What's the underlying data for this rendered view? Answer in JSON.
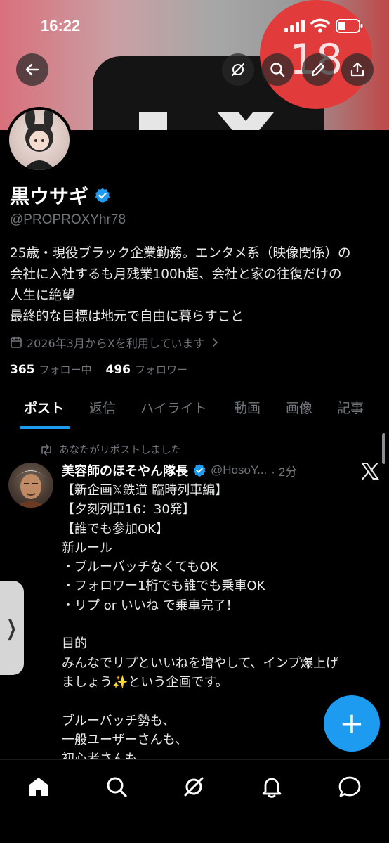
{
  "status_bar": {
    "time": "16:22"
  },
  "banner": {
    "badge_count": "18"
  },
  "top_actions": [
    {
      "name": "back-button",
      "icon": "arrow-left-icon"
    },
    {
      "name": "grok-button",
      "icon": "grok-icon"
    },
    {
      "name": "search-button",
      "icon": "search-icon"
    },
    {
      "name": "edit-button",
      "icon": "pencil-icon"
    },
    {
      "name": "share-button",
      "icon": "share-icon"
    }
  ],
  "profile": {
    "display_name": "黒ウサギ",
    "handle": "@PROPROXYhr78",
    "bio_lines": [
      "25歳・現役ブラック企業勤務。エンタメ系（映像関係）の",
      "会社に入社するも月残業100h超、会社と家の往復だけの",
      "人生に絶望",
      "最終的な目標は地元で自由に暮らすこと"
    ],
    "joined": "2026年3月からXを利用しています",
    "following_count": "365",
    "following_label": "フォロー中",
    "followers_count": "496",
    "followers_label": "フォロワー"
  },
  "tabs": [
    {
      "label": "ポスト",
      "active": true
    },
    {
      "label": "返信",
      "active": false
    },
    {
      "label": "ハイライト",
      "active": false
    },
    {
      "label": "動画",
      "active": false
    },
    {
      "label": "画像",
      "active": false
    },
    {
      "label": "記事",
      "active": false
    }
  ],
  "post": {
    "repost_label": "あなたがリポストしました",
    "author_name": "美容師のほそやん隊長",
    "author_handle": "@HosoY...",
    "time": "· 2分",
    "body_lines": [
      "【新企画𝕏鉄道 臨時列車編】",
      "【夕刻列車16：30発】",
      "【誰でも参加OK】",
      "新ルール",
      "・ブルーバッチなくてもOK",
      "・フォロワー1桁でも誰でも乗車OK",
      "・リプ or いいね で乗車完了！",
      "",
      "目的",
      "みんなでリプといいねを増やして、インプ爆上げ",
      "ましょう✨という企画です。",
      "",
      "ブルーバッチ勢も、",
      "一般ユーザーさんも、",
      "初心者さんも"
    ]
  },
  "fab": {
    "label": "+"
  },
  "bottom_nav": [
    {
      "name": "home",
      "icon": "home-icon"
    },
    {
      "name": "search",
      "icon": "search-icon"
    },
    {
      "name": "grok",
      "icon": "grok-icon"
    },
    {
      "name": "notifications",
      "icon": "bell-icon"
    },
    {
      "name": "messages",
      "icon": "chat-icon"
    }
  ],
  "colors": {
    "accent": "#1d9bf0",
    "background": "#000000",
    "secondary_text": "#71767b"
  }
}
